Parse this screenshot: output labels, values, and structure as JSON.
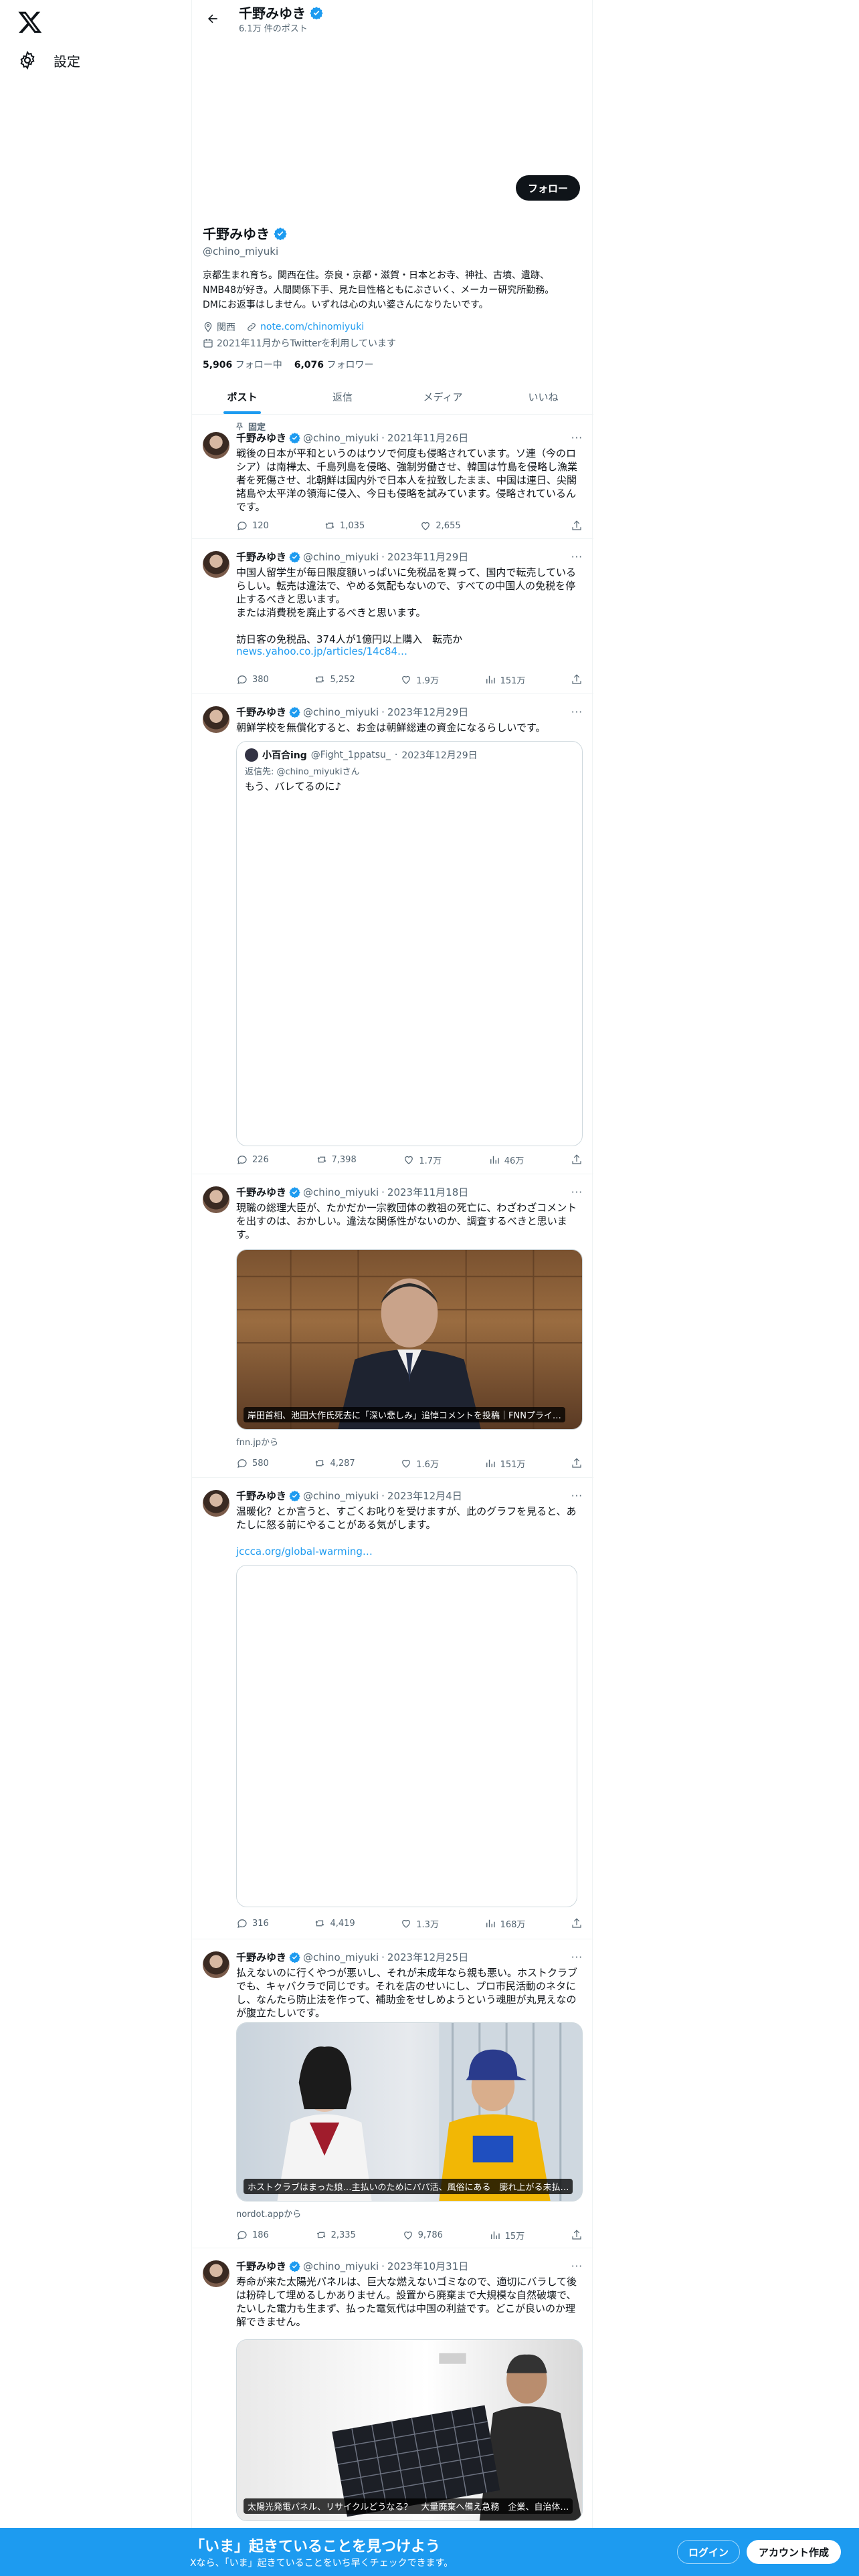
{
  "nav": {
    "settings_label": "設定"
  },
  "header": {
    "name": "千野みゆき",
    "post_count": "6.1万 件のポスト"
  },
  "profile": {
    "name": "千野みゆき",
    "handle": "@chino_miyuki",
    "follow_label": "フォロー",
    "bio": "京都生まれ育ち。関西在住。奈良・京都・滋賀・日本とお寺、神社、古墳、遺跡、\nNMB48が好き。人間関係下手、見た目性格ともにぶさいく、メーカー研究所勤務。\nDMにお返事はしません。いずれは心の丸い婆さんになりたいです。",
    "location": "関西",
    "link": "note.com/chinomiyuki",
    "joined": "2021年11月からTwitterを利用しています",
    "following_count": "5,906",
    "following_label": "フォロー中",
    "followers_count": "6,076",
    "followers_label": "フォロワー"
  },
  "tabs": [
    "ポスト",
    "返信",
    "メディア",
    "いいね"
  ],
  "tweets": [
    {
      "pinned": "固定",
      "name": "千野みゆき",
      "handle": "@chino_miyuki",
      "date": "2021年11月26日",
      "text": "戦後の日本が平和というのはウソで何度も侵略されています。ソ連（今のロシア）は南樺太、千島列島を侵略、強制労働させ、韓国は竹島を侵略し漁業者を死傷させ、北朝鮮は国内外で日本人を拉致したまま、中国は連日、尖閣諸島や太平洋の領海に侵入、今日も侵略を試みています。侵略されているんです。",
      "replies": "120",
      "reposts": "1,035",
      "likes": "2,655",
      "views": ""
    },
    {
      "name": "千野みゆき",
      "handle": "@chino_miyuki",
      "date": "2023年11月29日",
      "text": "中国人留学生が毎日限度額いっぱいに免税品を買って、国内で転売しているらしい。転売は違法で、やめる気配もないので、すべての中国人の免税を停止するべきと思います。\nまたは消費税を廃止するべきと思います。\n\n訪日客の免税品、374人が1億円以上購入　転売か",
      "link": "news.yahoo.co.jp/articles/14c84…",
      "replies": "380",
      "reposts": "5,252",
      "likes": "1.9万",
      "views": "151万"
    },
    {
      "name": "千野みゆき",
      "handle": "@chino_miyuki",
      "date": "2023年12月29日",
      "text": "朝鮮学校を無償化すると、お金は朝鮮総連の資金になるらしいです。",
      "quote": {
        "name": "小百合ing",
        "handle": "@Fight_1ppatsu_",
        "date": "2023年12月29日",
        "reply_to": "返信先: @chino_miyukiさん",
        "text": "もう、バレてるのに♪"
      },
      "replies": "226",
      "reposts": "7,398",
      "likes": "1.7万",
      "views": "46万"
    },
    {
      "name": "千野みゆき",
      "handle": "@chino_miyuki",
      "date": "2023年11月18日",
      "text": "現職の総理大臣が、たかだか一宗教団体の教祖の死亡に、わざわざコメントを出すのは、おかしい。違法な関係性がないのか、調査するべきと思います。",
      "media_caption": "岸田首相、池田大作氏死去に「深い悲しみ」追悼コメントを投稿｜FNNプライ…",
      "source": "fnn.jpから",
      "replies": "580",
      "reposts": "4,287",
      "likes": "1.6万",
      "views": "151万"
    },
    {
      "name": "千野みゆき",
      "handle": "@chino_miyuki",
      "date": "2023年12月4日",
      "text": "温暖化？とか言うと、すごくお叱りを受けますが、此のグラフを見ると、あたしに怒る前にやることがある気がします。",
      "link": "jccca.org/global-warming…",
      "replies": "316",
      "reposts": "4,419",
      "likes": "1.3万",
      "views": "168万"
    },
    {
      "name": "千野みゆき",
      "handle": "@chino_miyuki",
      "date": "2023年12月25日",
      "text": "払えないのに行くやつが悪いし、それが未成年なら親も悪い。ホストクラブでも、キャバクラで同じです。それを店のせいにし、プロ市民活動のネタにし、なんたら防止法を作って、補助金をせしめようという魂胆が丸見えなのが腹立たしいです。",
      "media_caption": "ホストクラブはまった娘…主払いのためにパパ活、風俗にある　膨れ上がる未払…",
      "source": "nordot.appから",
      "replies": "186",
      "reposts": "2,335",
      "likes": "9,786",
      "views": "15万"
    },
    {
      "name": "千野みゆき",
      "handle": "@chino_miyuki",
      "date": "2023年10月31日",
      "text": "寿命が来た太陽光パネルは、巨大な燃えないゴミなので、適切にバラして後は粉砕して埋めるしかありません。設置から廃棄まで大規模な自然破壊で、たいした電力も生まず、払った電気代は中国の利益です。どこが良いのか理解できません。",
      "media_caption": "太陽光発電パネル、リサイクルどうなる？　大量廃棄へ備え急務　企業、自治体…"
    }
  ],
  "banner": {
    "title": "「いま」起きていることを見つけよう",
    "subtitle": "Xなら、「いま」起きていることをいち早くチェックできます。",
    "login_label": "ログイン",
    "signup_label": "アカウント作成"
  },
  "colors": {
    "accent": "#1d9bf0",
    "text": "#0f1419",
    "muted": "#536471",
    "border": "#eff3f4"
  }
}
